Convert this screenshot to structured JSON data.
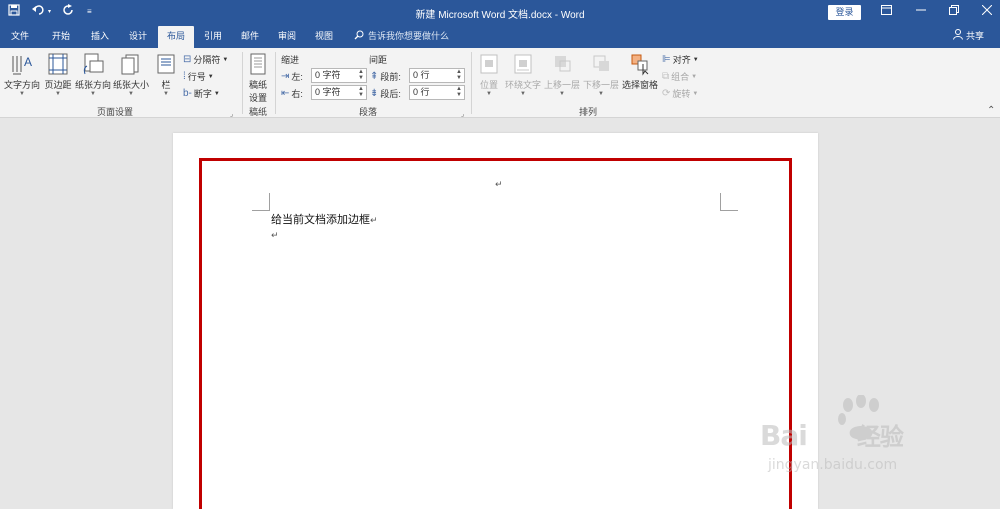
{
  "titlebar": {
    "title": "新建 Microsoft Word 文档.docx - Word",
    "login": "登录",
    "qat_icons": [
      "save-icon",
      "undo-icon",
      "redo-icon",
      "customize-qat-icon"
    ]
  },
  "tabs": {
    "items": [
      "文件",
      "开始",
      "插入",
      "设计",
      "布局",
      "引用",
      "邮件",
      "审阅",
      "视图"
    ],
    "active": "布局",
    "tell_me": "告诉我你想要做什么",
    "share": "共享"
  },
  "ribbon": {
    "page_setup": {
      "label": "页面设置",
      "text_direction": "文字方向",
      "margins": "页边距",
      "orientation": "纸张方向",
      "size": "纸张大小",
      "columns": "栏",
      "breaks": "分隔符",
      "line_numbers": "行号",
      "hyphenation": "断字"
    },
    "draft": {
      "label": "稿纸",
      "button_line1": "稿纸",
      "button_line2": "设置"
    },
    "paragraph": {
      "label": "段落",
      "indent_header": "缩进",
      "spacing_header": "间距",
      "left_label": "左:",
      "right_label": "右:",
      "before_label": "段前:",
      "after_label": "段后:",
      "left_value": "0 字符",
      "right_value": "0 字符",
      "before_value": "0 行",
      "after_value": "0 行"
    },
    "arrange": {
      "label": "排列",
      "position": "位置",
      "wrap_text": "环绕文字",
      "bring_forward": "上移一层",
      "send_backward": "下移一层",
      "selection_pane": "选择窗格",
      "align": "对齐",
      "group": "组合",
      "rotate": "旋转"
    }
  },
  "document": {
    "text": "给当前文档添加边框",
    "border_color": "#c00000"
  },
  "watermark": {
    "brand": "Bai",
    "brand_cn": "经验",
    "url": "jingyan.baidu.com"
  }
}
